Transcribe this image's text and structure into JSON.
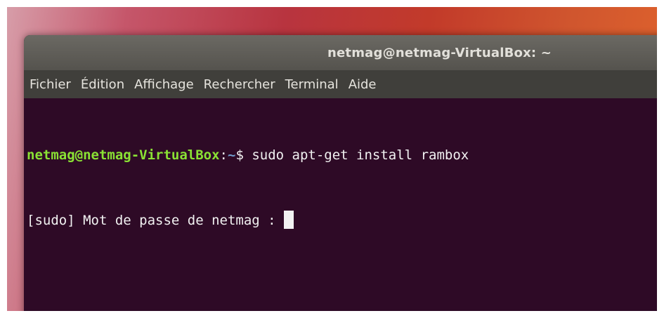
{
  "window": {
    "title": "netmag@netmag-VirtualBox: ~"
  },
  "menu": {
    "items": [
      "Fichier",
      "Édition",
      "Affichage",
      "Rechercher",
      "Terminal",
      "Aide"
    ]
  },
  "terminal": {
    "line1": {
      "user_host": "netmag@netmag-VirtualBox",
      "sep": ":",
      "path": "~",
      "dollar": "$",
      "command": " sudo apt-get install rambox"
    },
    "line2": {
      "text": "[sudo] Mot de passe de netmag : "
    }
  },
  "colors": {
    "terminal_bg": "#2e0a26",
    "prompt_green": "#8ae234",
    "path_blue": "#729fcf",
    "menubar_bg": "#403f3b",
    "titlebar_bg": "#55534e"
  }
}
